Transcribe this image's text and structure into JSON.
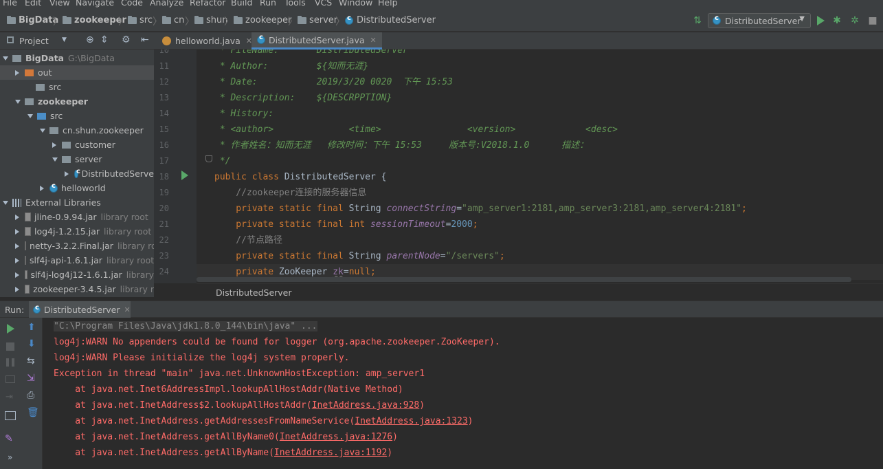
{
  "menu": [
    "File",
    "Edit",
    "View",
    "Navigate",
    "Code",
    "Analyze",
    "Refactor",
    "Build",
    "Run",
    "Tools",
    "VCS",
    "Window",
    "Help"
  ],
  "nav": {
    "crumbs": [
      "BigData",
      "zookeeper",
      "src",
      "cn",
      "shun",
      "zookeeper",
      "server",
      "DistributedServer"
    ],
    "run_config": "DistributedServer"
  },
  "project": {
    "header_label": "Project",
    "tree": [
      {
        "label": "BigData",
        "note": "G:\\BigData"
      },
      {
        "label": "out"
      },
      {
        "label": "src"
      },
      {
        "label": "zookeeper"
      },
      {
        "label": "src"
      },
      {
        "label": "cn.shun.zookeeper"
      },
      {
        "label": "customer"
      },
      {
        "label": "server"
      },
      {
        "label": "DistributedServe"
      },
      {
        "label": "helloworld"
      },
      {
        "label": "External Libraries"
      },
      {
        "label": "jline-0.9.94.jar",
        "note": "library root"
      },
      {
        "label": "log4j-1.2.15.jar",
        "note": "library root"
      },
      {
        "label": "netty-3.2.2.Final.jar",
        "note": "library ro"
      },
      {
        "label": "slf4j-api-1.6.1.jar",
        "note": "library root"
      },
      {
        "label": "slf4j-log4j12-1.6.1.jar",
        "note": "library"
      },
      {
        "label": "zookeeper-3.4.5.jar",
        "note": "library r"
      }
    ]
  },
  "editor": {
    "tabs": [
      "helloworld.java",
      "DistributedServer.java"
    ],
    "top_partial": " * FileName:       DistributedServer",
    "lines": [
      {
        "n": "10"
      },
      {
        "n": "11",
        "parts": [
          {
            "c": "doc",
            "t": " * Author:         ${知而无涯}"
          }
        ]
      },
      {
        "n": "12",
        "parts": [
          {
            "c": "doc",
            "t": " * Date:           2019/3/20 0020  下午 15:53"
          }
        ]
      },
      {
        "n": "13",
        "parts": [
          {
            "c": "doc",
            "t": " * Description:    ${DESCRPPTION}"
          }
        ]
      },
      {
        "n": "14",
        "parts": [
          {
            "c": "doc",
            "t": " * History:"
          }
        ]
      },
      {
        "n": "15",
        "parts": [
          {
            "c": "doc",
            "t": " * <author>              <time>                <version>             <desc>"
          }
        ]
      },
      {
        "n": "16",
        "parts": [
          {
            "c": "doc",
            "t": " * 作者姓名：知而无涯   修改时间：下午 15:53     版本号:V2018.1.0      描述："
          }
        ]
      },
      {
        "n": "17",
        "parts": [
          {
            "c": "doc",
            "t": " */"
          }
        ]
      },
      {
        "n": "18",
        "parts": [
          {
            "c": "kw",
            "t": "public class "
          },
          {
            "c": "plain",
            "t": "DistributedServer {"
          }
        ]
      },
      {
        "n": "19",
        "parts": [
          {
            "c": "cmt",
            "t": "    //zookeeper连接的服务器信息"
          }
        ]
      },
      {
        "n": "20",
        "parts": [
          {
            "c": "kw",
            "t": "    private static final "
          },
          {
            "c": "plain",
            "t": "String "
          },
          {
            "c": "fld",
            "t": "connectString"
          },
          {
            "c": "plain",
            "t": "="
          },
          {
            "c": "str",
            "t": "\"amp_server1:2181,amp_server3:2181,amp_server4:2181\""
          },
          {
            "c": "kw",
            "t": ";"
          }
        ]
      },
      {
        "n": "21",
        "parts": [
          {
            "c": "kw",
            "t": "    private static final int "
          },
          {
            "c": "fld",
            "t": "sessionTimeout"
          },
          {
            "c": "plain",
            "t": "="
          },
          {
            "c": "num",
            "t": "2000"
          },
          {
            "c": "kw",
            "t": ";"
          }
        ]
      },
      {
        "n": "22",
        "parts": [
          {
            "c": "cmt",
            "t": "    //节点路径"
          }
        ]
      },
      {
        "n": "23",
        "parts": [
          {
            "c": "kw",
            "t": "    private static final "
          },
          {
            "c": "plain",
            "t": "String "
          },
          {
            "c": "fld",
            "t": "parentNode"
          },
          {
            "c": "plain",
            "t": "="
          },
          {
            "c": "str",
            "t": "\"/servers\""
          },
          {
            "c": "kw",
            "t": ";"
          }
        ]
      },
      {
        "n": "24",
        "parts": [
          {
            "c": "kw",
            "t": "    private "
          },
          {
            "c": "plain",
            "t": "ZooKeeper "
          },
          {
            "c": "fld2",
            "t": "zk"
          },
          {
            "c": "plain",
            "t": "="
          },
          {
            "c": "kw",
            "t": "null;"
          }
        ]
      }
    ],
    "breadcrumb": "DistributedServer"
  },
  "run": {
    "label": "Run:",
    "tab": "DistributedServer",
    "console": [
      {
        "c": "grey",
        "t": "\"C:\\Program Files\\Java\\jdk1.8.0_144\\bin\\java\" ..."
      },
      {
        "c": "red",
        "t": "log4j:WARN No appenders could be found for logger (org.apache.zookeeper.ZooKeeper)."
      },
      {
        "c": "red",
        "t": "log4j:WARN Please initialize the log4j system properly."
      },
      {
        "c": "red",
        "t": "Exception in thread \"main\" java.net.UnknownHostException: amp_server1"
      },
      {
        "c": "red",
        "t": "    at java.net.Inet6AddressImpl.lookupAllHostAddr(Native Method)"
      },
      {
        "c": "red",
        "pre": "    at java.net.InetAddress$2.lookupAllHostAddr(",
        "link": "InetAddress.java:928",
        "post": ")"
      },
      {
        "c": "red",
        "pre": "    at java.net.InetAddress.getAddressesFromNameService(",
        "link": "InetAddress.java:1323",
        "post": ")"
      },
      {
        "c": "red",
        "pre": "    at java.net.InetAddress.getAllByName0(",
        "link": "InetAddress.java:1276",
        "post": ")"
      },
      {
        "c": "red",
        "pre": "    at java.net.InetAddress.getAllByName(",
        "link": "InetAddress.java:1192",
        "post": ")"
      }
    ]
  },
  "colors": {
    "accent": "#4a88c7",
    "run_green": "#59a869",
    "error_red": "#ff6b68"
  }
}
